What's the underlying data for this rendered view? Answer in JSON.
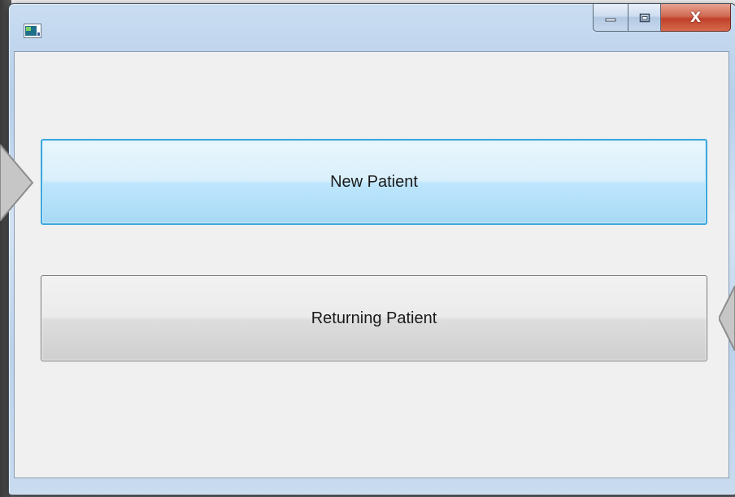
{
  "window": {
    "title": "",
    "icon": "app-window-icon",
    "caption_buttons": [
      {
        "name": "minimize",
        "icon": "minimize-icon"
      },
      {
        "name": "maximize",
        "icon": "maximize-icon"
      },
      {
        "name": "close",
        "icon": "close-icon",
        "label": "X"
      }
    ]
  },
  "main": {
    "new_patient_label": "New Patient",
    "returning_patient_label": "Returning Patient"
  },
  "colors": {
    "focused_border": "#3ca8dc",
    "focused_fill": "#bee6fd",
    "button_fill": "#dddddd",
    "client_background": "#f0f0f0",
    "close_button": "#c0412a"
  },
  "overlays": {
    "left_arrow_icon": "arrow-right-callout-icon",
    "right_arrow_icon": "arrow-left-callout-icon"
  }
}
